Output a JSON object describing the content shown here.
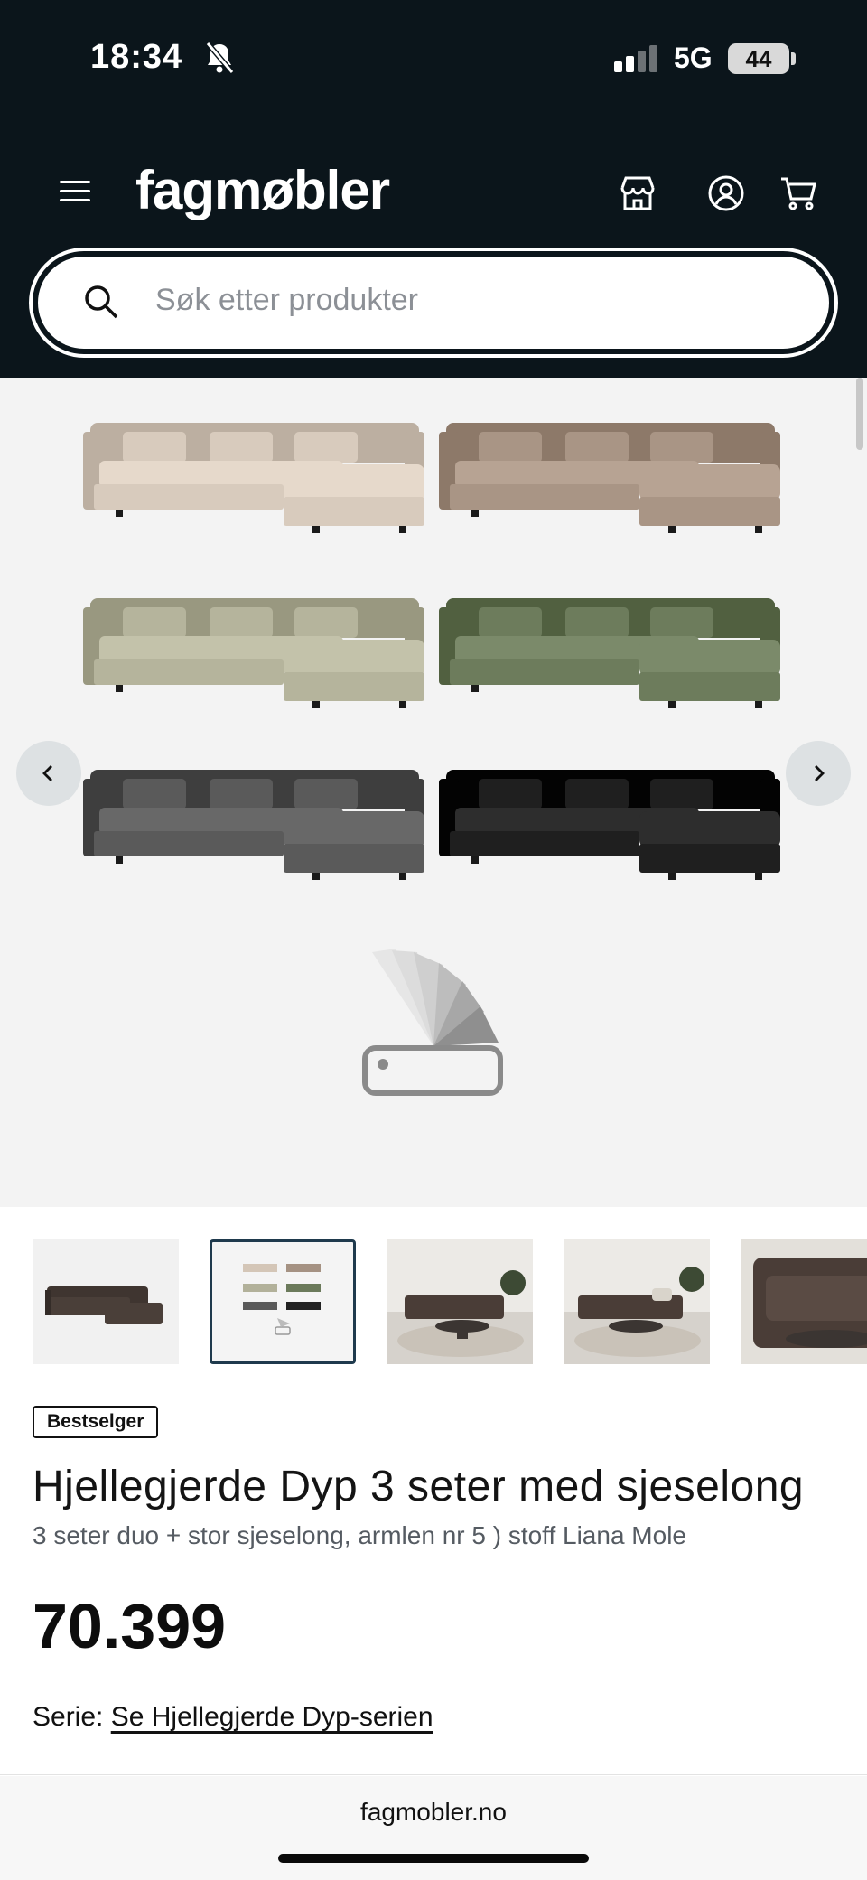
{
  "status_bar": {
    "time": "18:34",
    "network": "5G",
    "battery": "44"
  },
  "header": {
    "logo": "fagmøbler",
    "search_placeholder": "Søk etter produkter"
  },
  "gallery": {
    "sofa_colors": [
      "#d8cbbd",
      "#a99585",
      "#b5b49c",
      "#6d7c5c",
      "#5a5a5a",
      "#1f1f1f"
    ]
  },
  "thumbnails": [
    {
      "name": "sofa-dark-brown"
    },
    {
      "name": "color-variants"
    },
    {
      "name": "living-room-1"
    },
    {
      "name": "living-room-2"
    },
    {
      "name": "sofa-detail"
    }
  ],
  "product": {
    "badge": "Bestselger",
    "title": "Hjellegjerde Dyp 3 seter med sjeselong",
    "subtitle": "3 seter duo + stor sjeselong, armlen nr 5 ) stoff Liana Mole",
    "price": "70.399",
    "series_label": "Serie:",
    "series_link": "Se Hjellegjerde Dyp-serien"
  },
  "browser": {
    "url": "fagmobler.no"
  },
  "colors": {
    "header_bg": "#0b151b",
    "gallery_bg": "#f3f3f3"
  }
}
